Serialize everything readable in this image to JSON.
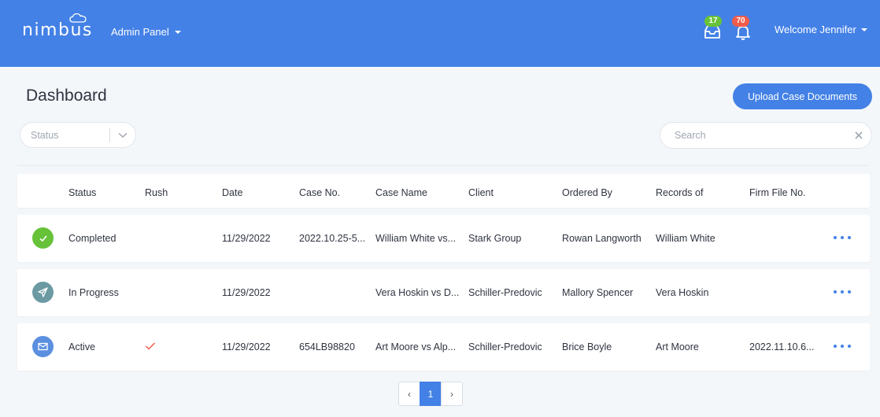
{
  "header": {
    "logo_text": "nimbus",
    "admin_menu_label": "Admin Panel",
    "inbox_badge": "17",
    "notifications_badge": "70",
    "welcome_label": "Welcome Jennifer",
    "brand_color": "#4381e6"
  },
  "page": {
    "title": "Dashboard",
    "upload_button_label": "Upload Case Documents",
    "status_filter_placeholder": "Status",
    "search_placeholder": "Search"
  },
  "table": {
    "headers": {
      "status": "Status",
      "rush": "Rush",
      "date": "Date",
      "case_no": "Case No.",
      "case_name": "Case Name",
      "client": "Client",
      "ordered_by": "Ordered By",
      "records_of": "Records of",
      "firm_file_no": "Firm File No."
    },
    "rows": [
      {
        "status": "Completed",
        "status_icon": "check-icon",
        "status_color": "#67c23a",
        "rush": false,
        "date": "11/29/2022",
        "case_no": "2022.10.25-5...",
        "case_name": "William White vs...",
        "client": "Stark Group",
        "ordered_by": "Rowan Langworth",
        "records_of": "William White",
        "firm_file_no": ""
      },
      {
        "status": "In Progress",
        "status_icon": "paper-plane-icon",
        "status_color": "#6b9aa3",
        "rush": false,
        "date": "11/29/2022",
        "case_no": "",
        "case_name": "Vera Hoskin vs D...",
        "client": "Schiller-Predovic",
        "ordered_by": "Mallory Spencer",
        "records_of": "Vera Hoskin",
        "firm_file_no": ""
      },
      {
        "status": "Active",
        "status_icon": "envelope-icon",
        "status_color": "#5b8fe0",
        "rush": true,
        "date": "11/29/2022",
        "case_no": "654LB98820",
        "case_name": "Art Moore vs Alp...",
        "client": "Schiller-Predovic",
        "ordered_by": "Brice Boyle",
        "records_of": "Art Moore",
        "firm_file_no": "2022.11.10.6..."
      }
    ]
  },
  "pagination": {
    "prev": "‹",
    "current": "1",
    "next": "›"
  }
}
